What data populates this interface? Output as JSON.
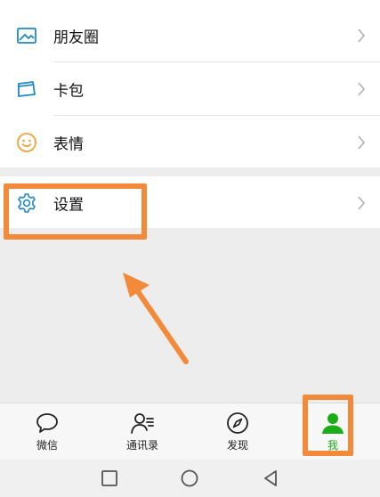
{
  "menu": {
    "items": [
      {
        "label": "朋友圈",
        "icon": "moments-icon"
      },
      {
        "label": "卡包",
        "icon": "card-wallet-icon"
      },
      {
        "label": "表情",
        "icon": "emoji-icon"
      }
    ],
    "settings": {
      "label": "设置",
      "icon": "gear-icon"
    }
  },
  "tabbar": {
    "tabs": [
      {
        "label": "微信",
        "icon": "chat-bubble-icon",
        "active": false
      },
      {
        "label": "通讯录",
        "icon": "contacts-icon",
        "active": false
      },
      {
        "label": "发现",
        "icon": "compass-icon",
        "active": false
      },
      {
        "label": "我",
        "icon": "person-icon",
        "active": true
      }
    ]
  },
  "system_nav": {
    "buttons": [
      "recents",
      "home",
      "back"
    ]
  },
  "colors": {
    "accent": "#1aad19",
    "highlight": "#f28a3a",
    "icon_blue": "#1e88c9",
    "emoji": "#f0a13a"
  }
}
